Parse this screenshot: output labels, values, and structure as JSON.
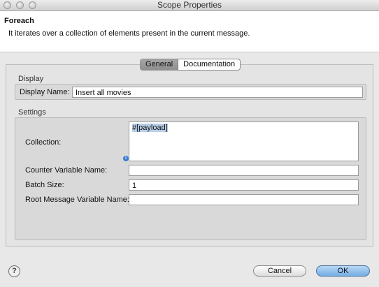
{
  "window": {
    "title": "Scope Properties"
  },
  "header": {
    "title": "Foreach",
    "description": "It iterates over a collection of elements present in the current message."
  },
  "tabs": [
    {
      "label": "General",
      "active": true
    },
    {
      "label": "Documentation",
      "active": false
    }
  ],
  "display": {
    "section_label": "Display",
    "display_name_label": "Display Name:",
    "display_name_value": "Insert all movies"
  },
  "settings": {
    "section_label": "Settings",
    "collection_label": "Collection:",
    "collection_value": "#[payload]",
    "counter_label": "Counter Variable Name:",
    "counter_value": "",
    "batch_label": "Batch Size:",
    "batch_value": "1",
    "root_label": "Root Message Variable Name:",
    "root_value": ""
  },
  "buttons": {
    "cancel": "Cancel",
    "ok": "OK",
    "help_glyph": "?"
  },
  "icons": {
    "info": "info-icon",
    "help": "help-icon"
  },
  "colors": {
    "ok_button": "#74aee4",
    "selection": "#b9cfe8"
  }
}
